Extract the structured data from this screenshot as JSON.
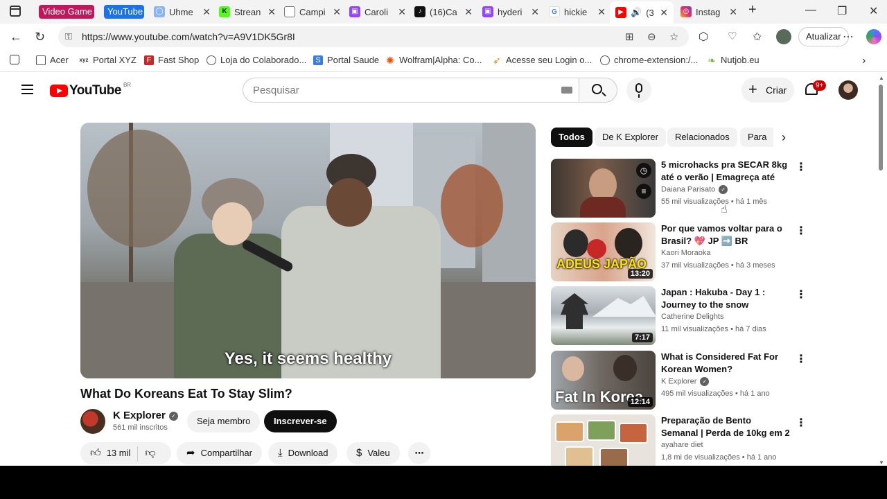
{
  "browser": {
    "tab_groups": [
      {
        "label": "Video Game",
        "color": "#c2185b"
      },
      {
        "label": "YouTube",
        "color": "#1a73e8"
      }
    ],
    "tabs": [
      {
        "title": "Uhme",
        "icon": "chat-bubble-icon",
        "color": "#8ab4f8"
      },
      {
        "title": "Strean",
        "icon": "kick-logo-icon",
        "color": "#53fc18"
      },
      {
        "title": "Campi",
        "icon": "globe-icon",
        "color": "#777777"
      },
      {
        "title": "Caroli",
        "icon": "twitch-icon",
        "color": "#9146ff"
      },
      {
        "title": "(16)Ca",
        "icon": "tiktok-icon",
        "color": "#111111"
      },
      {
        "title": "hyderi",
        "icon": "twitch-icon",
        "color": "#9146ff"
      },
      {
        "title": "hickie",
        "icon": "google-icon",
        "color": "#4285f4"
      },
      {
        "title": "(3",
        "icon": "youtube-icon",
        "color": "#ff0000",
        "active": true
      },
      {
        "title": "Instag",
        "icon": "instagram-icon",
        "color": "#e1306c"
      }
    ],
    "new_tab": "+",
    "url": "https://www.youtube.com/watch?v=A9V1DK5Gr8I",
    "update_label": "Atualizar",
    "bookmarks": [
      {
        "label": "Acer",
        "icon": "folder-icon"
      },
      {
        "label": "Portal XYZ",
        "icon": "xyz-logo-icon"
      },
      {
        "label": "Fast Shop",
        "icon": "fastshop-icon"
      },
      {
        "label": "Loja do Colaborado...",
        "icon": "globe-icon"
      },
      {
        "label": "Portal Saude",
        "icon": "portal-saude-icon"
      },
      {
        "label": "Wolfram|Alpha: Co...",
        "icon": "wolfram-icon"
      },
      {
        "label": "Acesse seu Login o...",
        "icon": "login-icon"
      },
      {
        "label": "chrome-extension:/...",
        "icon": "globe-icon"
      },
      {
        "label": "Nutjob.eu",
        "icon": "leaf-icon"
      }
    ]
  },
  "youtube": {
    "logo_text": "YouTube",
    "logo_country": "BR",
    "search_placeholder": "Pesquisar",
    "create_label": "Criar",
    "notifications_badge": "9+",
    "video": {
      "subtitle": "Yes, it seems healthy",
      "title": "What Do Koreans Eat To Stay Slim?",
      "channel": "K Explorer",
      "subscribers": "561 mil inscritos",
      "join_label": "Seja membro",
      "subscribe_label": "Inscrever-se",
      "likes": "13 mil",
      "share_label": "Compartilhar",
      "download_label": "Download",
      "thanks_label": "Valeu"
    },
    "chips": [
      "Todos",
      "De K Explorer",
      "Relacionados",
      "Para"
    ],
    "recommendations": [
      {
        "title": "5 microhacks pra SECAR 8kg até o verão | Emagreça até 8kg...",
        "channel": "Daiana Parisato",
        "verified": true,
        "views": "55 mil visualizações",
        "age": "há 1 mês",
        "duration": "",
        "thumb_text": "",
        "thumb_color": "#5d4a3e"
      },
      {
        "title": "Por que vamos voltar para o Brasil? 💖 JP ➡️ BR",
        "channel": "Kaori Moraoka",
        "verified": false,
        "views": "37 mil visualizações",
        "age": "há 3 meses",
        "duration": "13:20",
        "thumb_text": "ADEUS JAPÃO",
        "thumb_color": "#d6a98c"
      },
      {
        "title": "Japan : Hakuba - Day 1 : Journey to the snow",
        "channel": "Catherine Delights",
        "verified": false,
        "views": "11 mil visualizações",
        "age": "há 7 dias",
        "duration": "7:17",
        "thumb_text": "",
        "thumb_color": "#9aa3a8"
      },
      {
        "title": "What is Considered Fat For Korean Women?",
        "channel": "K Explorer",
        "verified": true,
        "views": "495 mil visualizações",
        "age": "há 1 ano",
        "duration": "12:14",
        "thumb_text": "Fat In Korea",
        "thumb_color": "#7c6f66"
      },
      {
        "title": "Preparação de Bento Semanal | Perda de 10kg em 2 Meses | ...",
        "channel": "ayahare diet",
        "verified": false,
        "views": "1,8 mi de visualizações",
        "age": "há 1 ano",
        "duration": "",
        "thumb_text": "",
        "thumb_color": "#c9a27a"
      }
    ]
  }
}
